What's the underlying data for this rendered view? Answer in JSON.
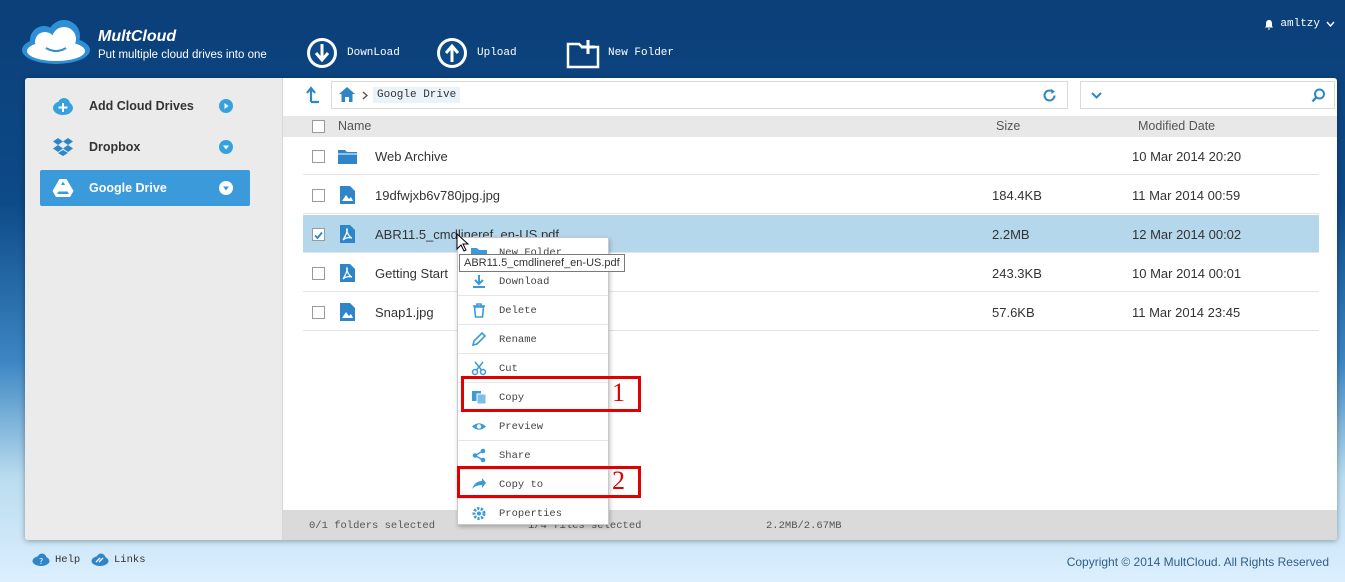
{
  "brand": {
    "name": "MultCloud",
    "tagline": "Put multiple cloud drives into one"
  },
  "toolbar": {
    "download": "DownLoad",
    "upload": "Upload",
    "new_folder": "New Folder"
  },
  "user": {
    "name": "amltzy"
  },
  "sidebar": {
    "items": [
      {
        "label": "Add Cloud Drives",
        "icon": "add-cloud-icon"
      },
      {
        "label": "Dropbox",
        "icon": "dropbox-icon"
      },
      {
        "label": "Google Drive",
        "icon": "google-drive-icon",
        "active": true
      }
    ]
  },
  "path": {
    "crumb": "Google Drive"
  },
  "table": {
    "headers": {
      "name": "Name",
      "size": "Size",
      "date": "Modified Date"
    },
    "rows": [
      {
        "name": "Web Archive",
        "size": "",
        "date": "10 Mar 2014 20:20",
        "type": "folder"
      },
      {
        "name": "19dfwjxb6v780jpg.jpg",
        "size": "184.4KB",
        "date": "11 Mar 2014 00:59",
        "type": "image"
      },
      {
        "name": "ABR11.5_cmdlineref_en-US.pdf",
        "size": "2.2MB",
        "date": "12 Mar 2014 00:02",
        "type": "pdf",
        "selected": true
      },
      {
        "name": "Getting Start",
        "size": "243.3KB",
        "date": "10 Mar 2014 00:01",
        "type": "pdf"
      },
      {
        "name": "Snap1.jpg",
        "size": "57.6KB",
        "date": "11 Mar 2014 23:45",
        "type": "image"
      }
    ]
  },
  "tooltip": "ABR11.5_cmdlineref_en-US.pdf",
  "context_menu": {
    "items": [
      {
        "label": "New Folder",
        "icon": "new-folder-icon"
      },
      {
        "label": "Download",
        "icon": "download-icon"
      },
      {
        "label": "Delete",
        "icon": "trash-icon"
      },
      {
        "label": "Rename",
        "icon": "pencil-icon"
      },
      {
        "label": "Cut",
        "icon": "scissors-icon"
      },
      {
        "label": "Copy",
        "icon": "copy-icon"
      },
      {
        "label": "Preview",
        "icon": "eye-icon"
      },
      {
        "label": "Share",
        "icon": "share-icon"
      },
      {
        "label": "Copy to",
        "icon": "copy-to-icon"
      },
      {
        "label": "Properties",
        "icon": "gear-icon"
      }
    ]
  },
  "annotations": {
    "step1": "1",
    "step2": "2"
  },
  "status": {
    "folders": "0/1 folders selected",
    "files": "1/4 files selected",
    "size": "2.2MB/2.67MB"
  },
  "footer": {
    "help": "Help",
    "links": "Links",
    "copyright": "Copyright © 2014 MultCloud. All Rights Reserved"
  },
  "colors": {
    "accent": "#3b9ad9",
    "selected_row": "#b5d7ec",
    "highlight": "#e00000",
    "header_bg": "#0d4a88"
  }
}
